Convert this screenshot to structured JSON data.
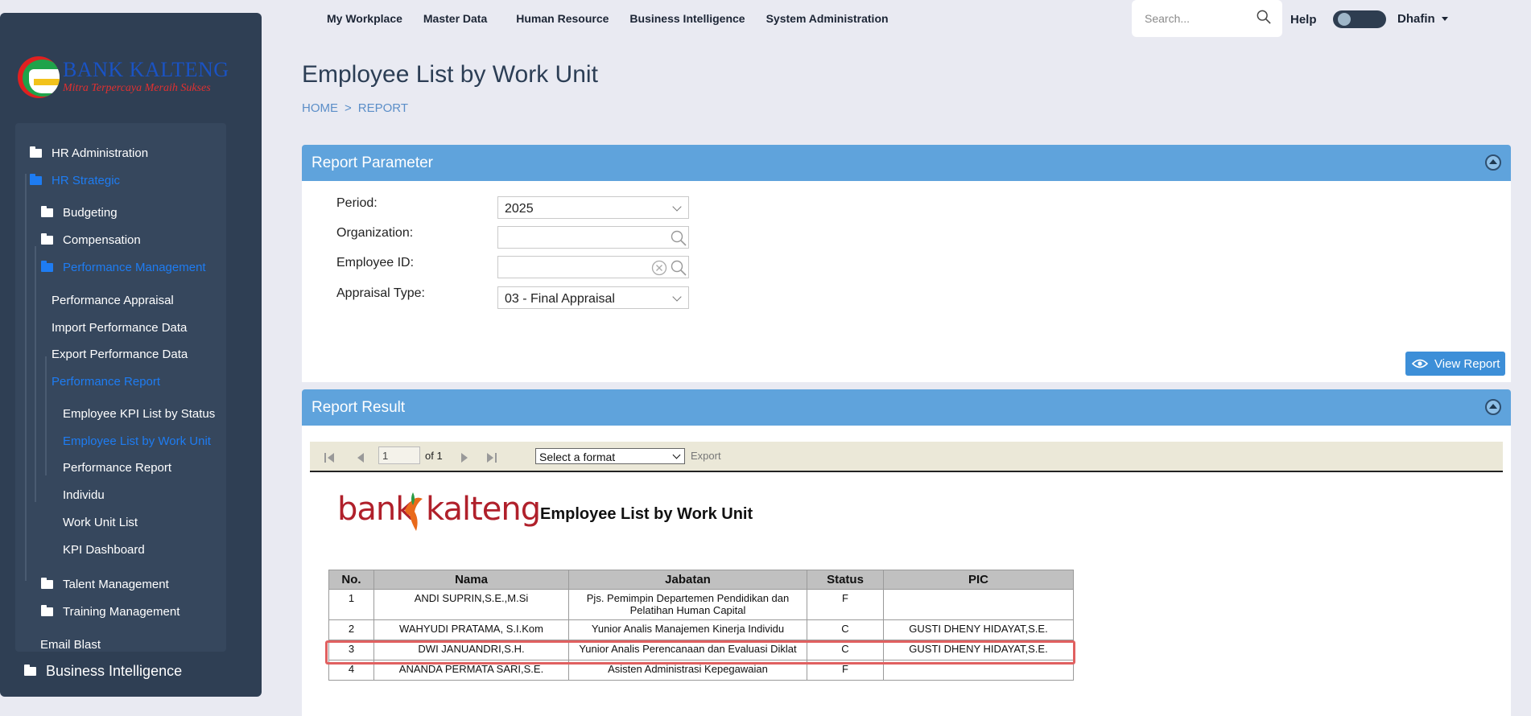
{
  "sidebar": {
    "logo": {
      "brand": "BANK KALTENG",
      "tagline": "Mitra Terpercaya Meraih Sukses"
    },
    "items": [
      {
        "label": "HR Administration"
      },
      {
        "label": "HR Strategic"
      },
      {
        "label": "Budgeting"
      },
      {
        "label": "Compensation"
      },
      {
        "label": "Performance Management"
      },
      {
        "label": "Performance Appraisal"
      },
      {
        "label": "Import Performance Data"
      },
      {
        "label": "Export Performance Data"
      },
      {
        "label": "Performance Report"
      },
      {
        "label": "Employee KPI List by Status"
      },
      {
        "label": "Employee List by Work Unit"
      },
      {
        "label": "Performance Report"
      },
      {
        "label": "Individu"
      },
      {
        "label": "Work Unit List"
      },
      {
        "label": "KPI Dashboard"
      },
      {
        "label": "Talent Management"
      },
      {
        "label": "Training Management"
      },
      {
        "label": "Email Blast"
      },
      {
        "label": "Business Intelligence"
      }
    ]
  },
  "topnav": {
    "items": [
      "My Workplace",
      "Master Data",
      "Human Resource",
      "Business Intelligence",
      "System Administration"
    ],
    "search_placeholder": "Search...",
    "help": "Help",
    "user": "Dhafin"
  },
  "page": {
    "title": "Employee List by Work Unit",
    "breadcrumb": [
      "HOME",
      "REPORT"
    ],
    "breadcrumb_sep": ">"
  },
  "param_panel": {
    "title": "Report Parameter",
    "labels": {
      "period": "Period:",
      "organization": "Organization:",
      "employee_id": "Employee ID:",
      "appraisal_type": "Appraisal Type:"
    },
    "values": {
      "period": "2025",
      "organization": "",
      "employee_id": "",
      "appraisal_type": "03 - Final Appraisal"
    },
    "view_button": "View Report"
  },
  "result_panel": {
    "title": "Report Result",
    "toolbar": {
      "page": "1",
      "of_pages": "of 1",
      "format_placeholder": "Select a format",
      "export": "Export"
    },
    "report": {
      "logo_text_left": "bank",
      "logo_text_right": "kalteng",
      "title": "Employee List by Work Unit",
      "columns": [
        "No.",
        "Nama",
        "Jabatan",
        "Status",
        "PIC"
      ],
      "rows": [
        {
          "no": "1",
          "nama": "ANDI SUPRIN,S.E.,M.Si",
          "jabatan": "Pjs. Pemimpin Departemen  Pendidikan dan Pelatihan Human Capital",
          "status": "F",
          "pic": ""
        },
        {
          "no": "2",
          "nama": "WAHYUDI PRATAMA, S.I.Kom",
          "jabatan": "Yunior Analis Manajemen Kinerja Individu",
          "status": "C",
          "pic": "GUSTI DHENY HIDAYAT,S.E."
        },
        {
          "no": "3",
          "nama": "DWI JANUANDRI,S.H.",
          "jabatan": "Yunior Analis Perencanaan dan  Evaluasi Diklat",
          "status": "C",
          "pic": "GUSTI DHENY HIDAYAT,S.E."
        },
        {
          "no": "4",
          "nama": "ANANDA PERMATA SARI,S.E.",
          "jabatan": "Asisten Administrasi Kepegawaian",
          "status": "F",
          "pic": ""
        }
      ]
    }
  },
  "colors": {
    "sidebar_bg": "#2f3f54",
    "accent": "#1e7cf2",
    "panel_header": "#5fa3dc",
    "highlight": "#e06060"
  }
}
